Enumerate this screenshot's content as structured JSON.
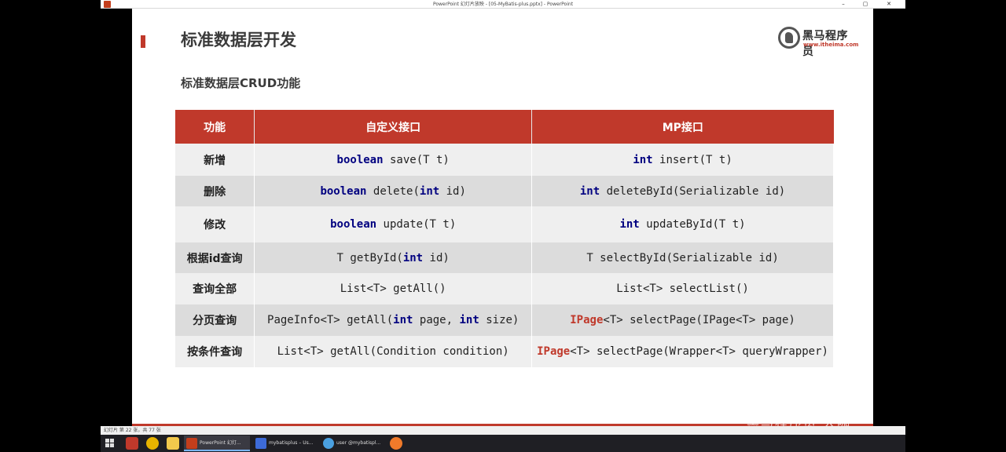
{
  "window": {
    "title": "PowerPoint 幻灯片放映 - [05-MyBatis-plus.pptx] - PowerPoint",
    "controls": {
      "minimize": "–",
      "maximize": "▢",
      "close": "✕"
    }
  },
  "slide": {
    "title": "标准数据层开发",
    "subtitle": "标准数据层CRUD功能",
    "logo": {
      "brand": "黑马程序员",
      "url": "www.itheima.com"
    }
  },
  "table": {
    "headers": [
      "功能",
      "自定义接口",
      "MP接口"
    ],
    "rows": [
      {
        "function": "新增",
        "custom": [
          {
            "t": "boolean",
            "k": "kw"
          },
          {
            "t": " save(T t)"
          }
        ],
        "mp": [
          {
            "t": "int",
            "k": "kw"
          },
          {
            "t": " insert(T t)"
          }
        ]
      },
      {
        "function": "删除",
        "custom": [
          {
            "t": "boolean",
            "k": "kw"
          },
          {
            "t": " delete("
          },
          {
            "t": "int",
            "k": "kw"
          },
          {
            "t": " id)"
          }
        ],
        "mp": [
          {
            "t": "int",
            "k": "kw"
          },
          {
            "t": " deleteById(Serializable id)"
          }
        ]
      },
      {
        "function": "修改",
        "custom": [
          {
            "t": "boolean",
            "k": "kw"
          },
          {
            "t": " update(T t)"
          }
        ],
        "mp": [
          {
            "t": "int",
            "k": "kw"
          },
          {
            "t": " updateById(T t)"
          }
        ]
      },
      {
        "function": "根据id查询",
        "custom": [
          {
            "t": "T getById("
          },
          {
            "t": "int",
            "k": "kw"
          },
          {
            "t": " id)"
          }
        ],
        "mp": [
          {
            "t": "T selectById(Serializable id)"
          }
        ]
      },
      {
        "function": "查询全部",
        "custom": [
          {
            "t": "List<T> getAll()"
          }
        ],
        "mp": [
          {
            "t": "List<T> selectList()"
          }
        ]
      },
      {
        "function": "分页查询",
        "custom": [
          {
            "t": "PageInfo<T> getAll("
          },
          {
            "t": "int",
            "k": "kw"
          },
          {
            "t": " page, "
          },
          {
            "t": "int",
            "k": "kw"
          },
          {
            "t": " size)"
          }
        ],
        "mp": [
          {
            "t": "IPage",
            "k": "ty"
          },
          {
            "t": "<T> selectPage(IPage<T> page)"
          }
        ]
      },
      {
        "function": "按条件查询",
        "custom": [
          {
            "t": "List<T> getAll(Condition condition)"
          }
        ],
        "mp": [
          {
            "t": "IPage",
            "k": "ty"
          },
          {
            "t": "<T> selectPage(Wrapper<T> queryWrapper)"
          }
        ]
      }
    ]
  },
  "statusbar": {
    "slide_info": "幻灯片 第 22 张，共 77 张"
  },
  "taskbar": {
    "apps": [
      {
        "label": "PowerPoint 幻灯...",
        "icon": "powerpoint-icon",
        "color": "#c43e1c",
        "active": true
      },
      {
        "label": "mybatisplus – Us...",
        "icon": "intellij-icon",
        "color": "#3d6bd8",
        "active": false
      },
      {
        "label": "user @mybatispl...",
        "icon": "navicat-icon",
        "color": "#4aa0e0",
        "active": false
      }
    ]
  },
  "watermark": "黑马程序员 大咖",
  "colors": {
    "accent": "#c0392b",
    "keyword": "#000080"
  }
}
